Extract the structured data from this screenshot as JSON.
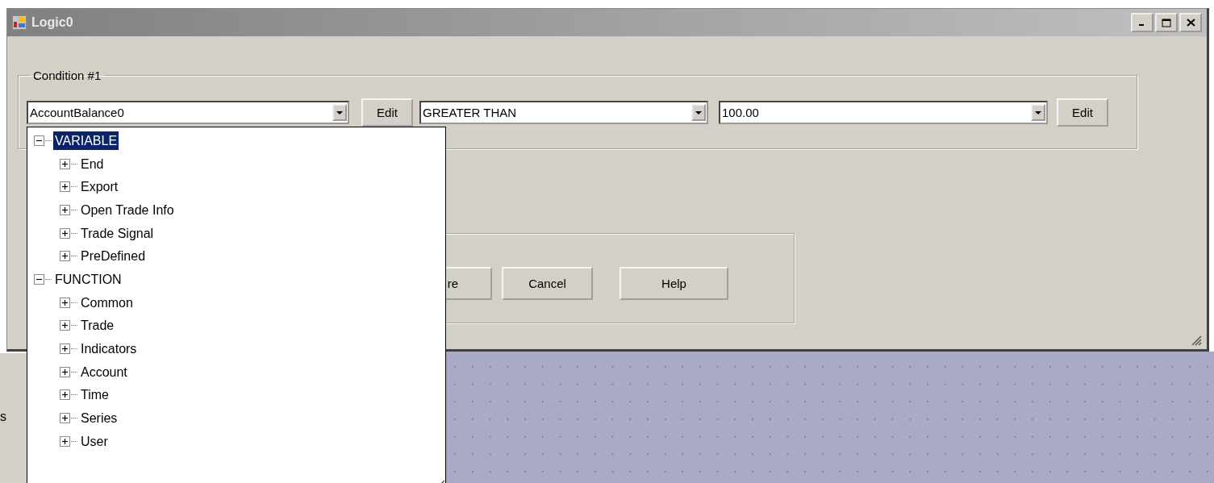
{
  "window": {
    "title": "Logic0"
  },
  "condition_group": {
    "label": "Condition #1",
    "left_operand": {
      "value": "AccountBalance0"
    },
    "left_edit_button": "Edit",
    "operator": {
      "value": "GREATER THAN"
    },
    "right_operand": {
      "value": "100.00"
    },
    "right_edit_button": "Edit"
  },
  "buttons": [
    {
      "label": "re"
    },
    {
      "label": "Cancel"
    },
    {
      "label": "Help"
    }
  ],
  "dropdown_tree": {
    "items": [
      {
        "label": "VARIABLE",
        "selected": true,
        "expanded": true,
        "children": [
          {
            "label": "End",
            "selected": false,
            "expanded": false
          },
          {
            "label": "Export",
            "selected": false,
            "expanded": false
          },
          {
            "label": "Open Trade Info",
            "selected": false,
            "expanded": false
          },
          {
            "label": "Trade Signal",
            "selected": false,
            "expanded": false
          },
          {
            "label": "PreDefined",
            "selected": false,
            "expanded": false
          }
        ]
      },
      {
        "label": "FUNCTION",
        "selected": false,
        "expanded": true,
        "children": [
          {
            "label": "Common",
            "selected": false,
            "expanded": false
          },
          {
            "label": "Trade",
            "selected": false,
            "expanded": false
          },
          {
            "label": "Indicators",
            "selected": false,
            "expanded": false
          },
          {
            "label": "Account",
            "selected": false,
            "expanded": false
          },
          {
            "label": "Time",
            "selected": false,
            "expanded": false
          },
          {
            "label": "Series",
            "selected": false,
            "expanded": false
          },
          {
            "label": "User",
            "selected": false,
            "expanded": false
          }
        ]
      }
    ]
  },
  "side_panel": {
    "text": "s"
  }
}
